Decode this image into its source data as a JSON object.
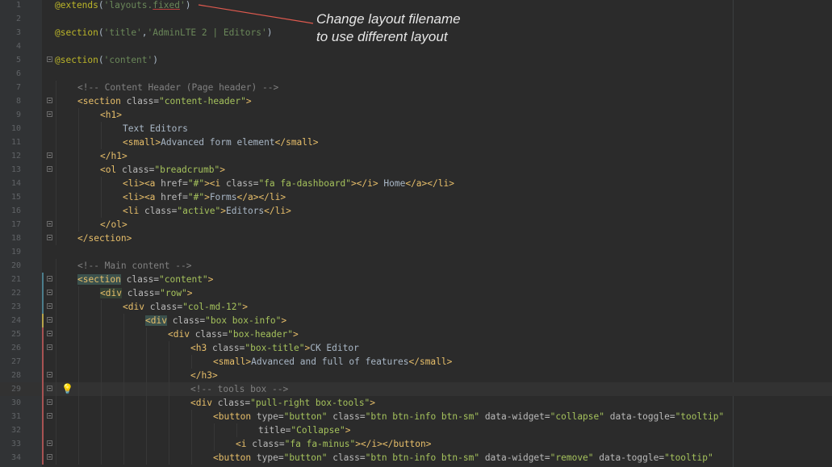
{
  "annotation": {
    "line1": "Change layout filename",
    "line2": "to use different layout"
  },
  "lines": [
    {
      "n": "1",
      "indent": 0,
      "segs": [
        [
          "d",
          "@extends"
        ],
        [
          "p",
          "("
        ],
        [
          "s",
          "'layouts."
        ],
        [
          "su",
          "fixed"
        ],
        [
          "s",
          "'"
        ],
        [
          "p",
          ")"
        ]
      ]
    },
    {
      "n": "2",
      "indent": 0,
      "segs": []
    },
    {
      "n": "3",
      "indent": 0,
      "segs": [
        [
          "d",
          "@section"
        ],
        [
          "p",
          "("
        ],
        [
          "s",
          "'title'"
        ],
        [
          "p",
          ","
        ],
        [
          "s",
          "'AdminLTE 2 | Editors'"
        ],
        [
          "p",
          ")"
        ]
      ]
    },
    {
      "n": "4",
      "indent": 0,
      "segs": []
    },
    {
      "n": "5",
      "indent": 0,
      "segs": [
        [
          "d",
          "@section"
        ],
        [
          "p",
          "("
        ],
        [
          "s",
          "'content'"
        ],
        [
          "p",
          ")"
        ]
      ]
    },
    {
      "n": "6",
      "indent": 0,
      "segs": []
    },
    {
      "n": "7",
      "indent": 1,
      "segs": [
        [
          "c",
          "<!-- Content Header (Page header) -->"
        ]
      ]
    },
    {
      "n": "8",
      "indent": 1,
      "segs": [
        [
          "t",
          "<section "
        ],
        [
          "a",
          "class="
        ],
        [
          "v",
          "\"content-header\""
        ],
        [
          "t",
          ">"
        ]
      ]
    },
    {
      "n": "9",
      "indent": 2,
      "segs": [
        [
          "t",
          "<h1>"
        ]
      ]
    },
    {
      "n": "10",
      "indent": 3,
      "segs": [
        [
          "p",
          "Text Editors"
        ]
      ]
    },
    {
      "n": "11",
      "indent": 3,
      "segs": [
        [
          "t",
          "<small>"
        ],
        [
          "p",
          "Advanced form element"
        ],
        [
          "t",
          "</small>"
        ]
      ]
    },
    {
      "n": "12",
      "indent": 2,
      "segs": [
        [
          "t",
          "</h1>"
        ]
      ]
    },
    {
      "n": "13",
      "indent": 2,
      "segs": [
        [
          "t",
          "<ol "
        ],
        [
          "a",
          "class="
        ],
        [
          "v",
          "\"breadcrumb\""
        ],
        [
          "t",
          ">"
        ]
      ]
    },
    {
      "n": "14",
      "indent": 3,
      "segs": [
        [
          "t",
          "<li><a "
        ],
        [
          "a",
          "href="
        ],
        [
          "v",
          "\"#\""
        ],
        [
          "t",
          "><i "
        ],
        [
          "a",
          "class="
        ],
        [
          "v",
          "\"fa fa-dashboard\""
        ],
        [
          "t",
          "></i>"
        ],
        [
          "p",
          " Home"
        ],
        [
          "t",
          "</a></li>"
        ]
      ]
    },
    {
      "n": "15",
      "indent": 3,
      "segs": [
        [
          "t",
          "<li><a "
        ],
        [
          "a",
          "href="
        ],
        [
          "v",
          "\"#\""
        ],
        [
          "t",
          ">"
        ],
        [
          "p",
          "Forms"
        ],
        [
          "t",
          "</a></li>"
        ]
      ]
    },
    {
      "n": "16",
      "indent": 3,
      "segs": [
        [
          "t",
          "<li "
        ],
        [
          "a",
          "class="
        ],
        [
          "v",
          "\"active\""
        ],
        [
          "t",
          ">"
        ],
        [
          "p",
          "Editors"
        ],
        [
          "t",
          "</li>"
        ]
      ]
    },
    {
      "n": "17",
      "indent": 2,
      "segs": [
        [
          "t",
          "</ol>"
        ]
      ]
    },
    {
      "n": "18",
      "indent": 1,
      "segs": [
        [
          "t",
          "</section>"
        ]
      ]
    },
    {
      "n": "19",
      "indent": 0,
      "segs": []
    },
    {
      "n": "20",
      "indent": 1,
      "segs": [
        [
          "c",
          "<!-- Main content -->"
        ]
      ]
    },
    {
      "n": "21",
      "indent": 1,
      "segs": [
        [
          "th",
          "<section"
        ],
        [
          "a",
          " class="
        ],
        [
          "v",
          "\"content\""
        ],
        [
          "t",
          ">"
        ]
      ]
    },
    {
      "n": "22",
      "indent": 2,
      "segs": [
        [
          "th2",
          "<div"
        ],
        [
          "a",
          " class="
        ],
        [
          "v",
          "\"row\""
        ],
        [
          "t",
          ">"
        ]
      ]
    },
    {
      "n": "23",
      "indent": 3,
      "segs": [
        [
          "t",
          "<div "
        ],
        [
          "a",
          "class="
        ],
        [
          "v",
          "\"col-md-12\""
        ],
        [
          "t",
          ">"
        ]
      ]
    },
    {
      "n": "24",
      "indent": 4,
      "segs": [
        [
          "th",
          "<div"
        ],
        [
          "a",
          " class="
        ],
        [
          "v",
          "\"box box-info\""
        ],
        [
          "t",
          ">"
        ]
      ]
    },
    {
      "n": "25",
      "indent": 5,
      "segs": [
        [
          "t",
          "<div "
        ],
        [
          "a",
          "class="
        ],
        [
          "v",
          "\"box-header\""
        ],
        [
          "t",
          ">"
        ]
      ]
    },
    {
      "n": "26",
      "indent": 6,
      "segs": [
        [
          "t",
          "<h3 "
        ],
        [
          "a",
          "class="
        ],
        [
          "v",
          "\"box-title\""
        ],
        [
          "t",
          ">"
        ],
        [
          "p",
          "CK Editor"
        ]
      ]
    },
    {
      "n": "27",
      "indent": 7,
      "segs": [
        [
          "t",
          "<small>"
        ],
        [
          "p",
          "Advanced and full of features"
        ],
        [
          "t",
          "</small>"
        ]
      ]
    },
    {
      "n": "28",
      "indent": 6,
      "segs": [
        [
          "t",
          "</h3>"
        ]
      ]
    },
    {
      "n": "29",
      "indent": 6,
      "segs": [
        [
          "c",
          "<!-- tools box -->"
        ]
      ]
    },
    {
      "n": "30",
      "indent": 6,
      "segs": [
        [
          "t",
          "<div "
        ],
        [
          "a",
          "class="
        ],
        [
          "v",
          "\"pull-right box-tools\""
        ],
        [
          "t",
          ">"
        ]
      ]
    },
    {
      "n": "31",
      "indent": 7,
      "segs": [
        [
          "t",
          "<button "
        ],
        [
          "a",
          "type="
        ],
        [
          "v",
          "\"button\""
        ],
        [
          "a",
          " class="
        ],
        [
          "v",
          "\"btn btn-info btn-sm\""
        ],
        [
          "a",
          " data-widget="
        ],
        [
          "v",
          "\"collapse\""
        ],
        [
          "a",
          " data-toggle="
        ],
        [
          "v",
          "\"tooltip\""
        ]
      ]
    },
    {
      "n": "32",
      "indent": 9,
      "segs": [
        [
          "a",
          "title="
        ],
        [
          "v",
          "\"Collapse\""
        ],
        [
          "t",
          ">"
        ]
      ]
    },
    {
      "n": "33",
      "indent": 8,
      "segs": [
        [
          "t",
          "<i "
        ],
        [
          "a",
          "class="
        ],
        [
          "v",
          "\"fa fa-minus\""
        ],
        [
          "t",
          "></i></button>"
        ]
      ]
    },
    {
      "n": "34",
      "indent": 7,
      "segs": [
        [
          "t",
          "<button "
        ],
        [
          "a",
          "type="
        ],
        [
          "v",
          "\"button\""
        ],
        [
          "a",
          " class="
        ],
        [
          "v",
          "\"btn btn-info btn-sm\""
        ],
        [
          "a",
          " data-widget="
        ],
        [
          "v",
          "\"remove\""
        ],
        [
          "a",
          " data-toggle="
        ],
        [
          "v",
          "\"tooltip\""
        ]
      ]
    }
  ],
  "colors": {
    "background": "#2b2b2b",
    "gutter": "#313335",
    "tag": "#e8bf6a",
    "attribute": "#bababa",
    "value": "#a5c25c",
    "comment": "#808080",
    "directive": "#bbb529",
    "string": "#6a8759",
    "annotation": "#e6e6e6",
    "arrow": "#e05a4f"
  },
  "icons": {
    "intention": "lightbulb-icon",
    "fold": "fold-marker-icon"
  }
}
